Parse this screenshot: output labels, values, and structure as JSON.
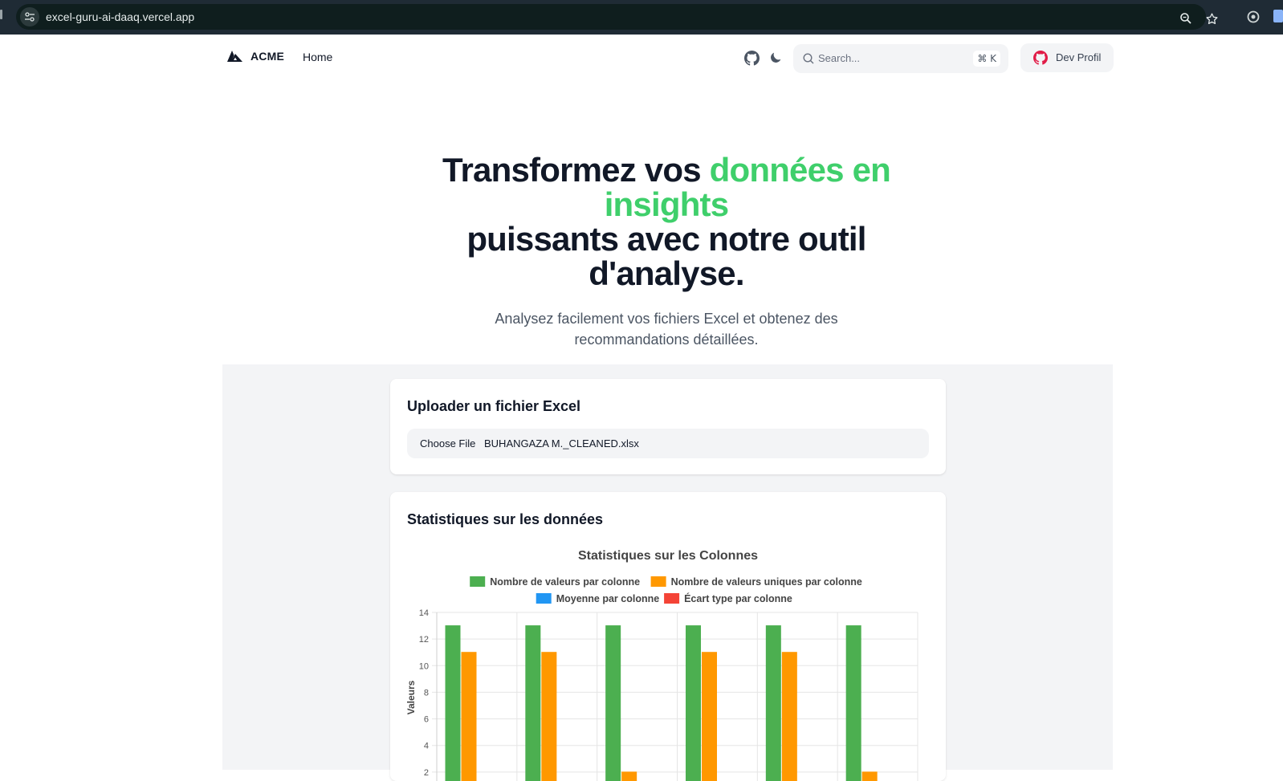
{
  "browser": {
    "url": "excel-guru-ai-daaq.vercel.app"
  },
  "header": {
    "brand": "ACME",
    "nav_home": "Home",
    "search_placeholder": "Search...",
    "search_shortcut": "⌘ K",
    "dev_profile_label": "Dev Profil"
  },
  "hero": {
    "title_part1": "Transformez vos ",
    "title_accent": "données en insights",
    "title_part2": "puissants avec notre outil d'analyse.",
    "subtitle": "Analysez facilement vos fichiers Excel et obtenez des recommandations détaillées."
  },
  "upload_card": {
    "title": "Uploader un fichier Excel",
    "choose_file_label": "Choose File",
    "file_name": "BUHANGAZA M._CLEANED.xlsx"
  },
  "stats_card": {
    "title": "Statistiques sur les données"
  },
  "colors": {
    "accent_green": "#3fcf6b",
    "series_count": "#4caf50",
    "series_unique": "#ff9800",
    "series_mean": "#2196f3",
    "series_std": "#f44336"
  },
  "chart_data": {
    "type": "bar",
    "title": "Statistiques sur les Colonnes",
    "ylabel": "Valeurs",
    "ylim": [
      0,
      14
    ],
    "yticks": [
      2,
      4,
      6,
      8,
      10,
      12,
      14
    ],
    "grid": true,
    "legend_position": "top",
    "categories": [
      "",
      "",
      "",
      "",
      "",
      ""
    ],
    "series": [
      {
        "name": "Nombre de valeurs par colonne",
        "color": "#4caf50",
        "values": [
          13,
          13,
          13,
          13,
          13,
          13
        ]
      },
      {
        "name": "Nombre de valeurs uniques par colonne",
        "color": "#ff9800",
        "values": [
          11,
          11,
          2,
          11,
          11,
          2
        ]
      },
      {
        "name": "Moyenne par colonne",
        "color": "#2196f3",
        "values": [
          null,
          null,
          null,
          null,
          null,
          null
        ]
      },
      {
        "name": "Écart type par colonne",
        "color": "#f44336",
        "values": [
          null,
          null,
          null,
          null,
          null,
          null
        ]
      }
    ]
  }
}
